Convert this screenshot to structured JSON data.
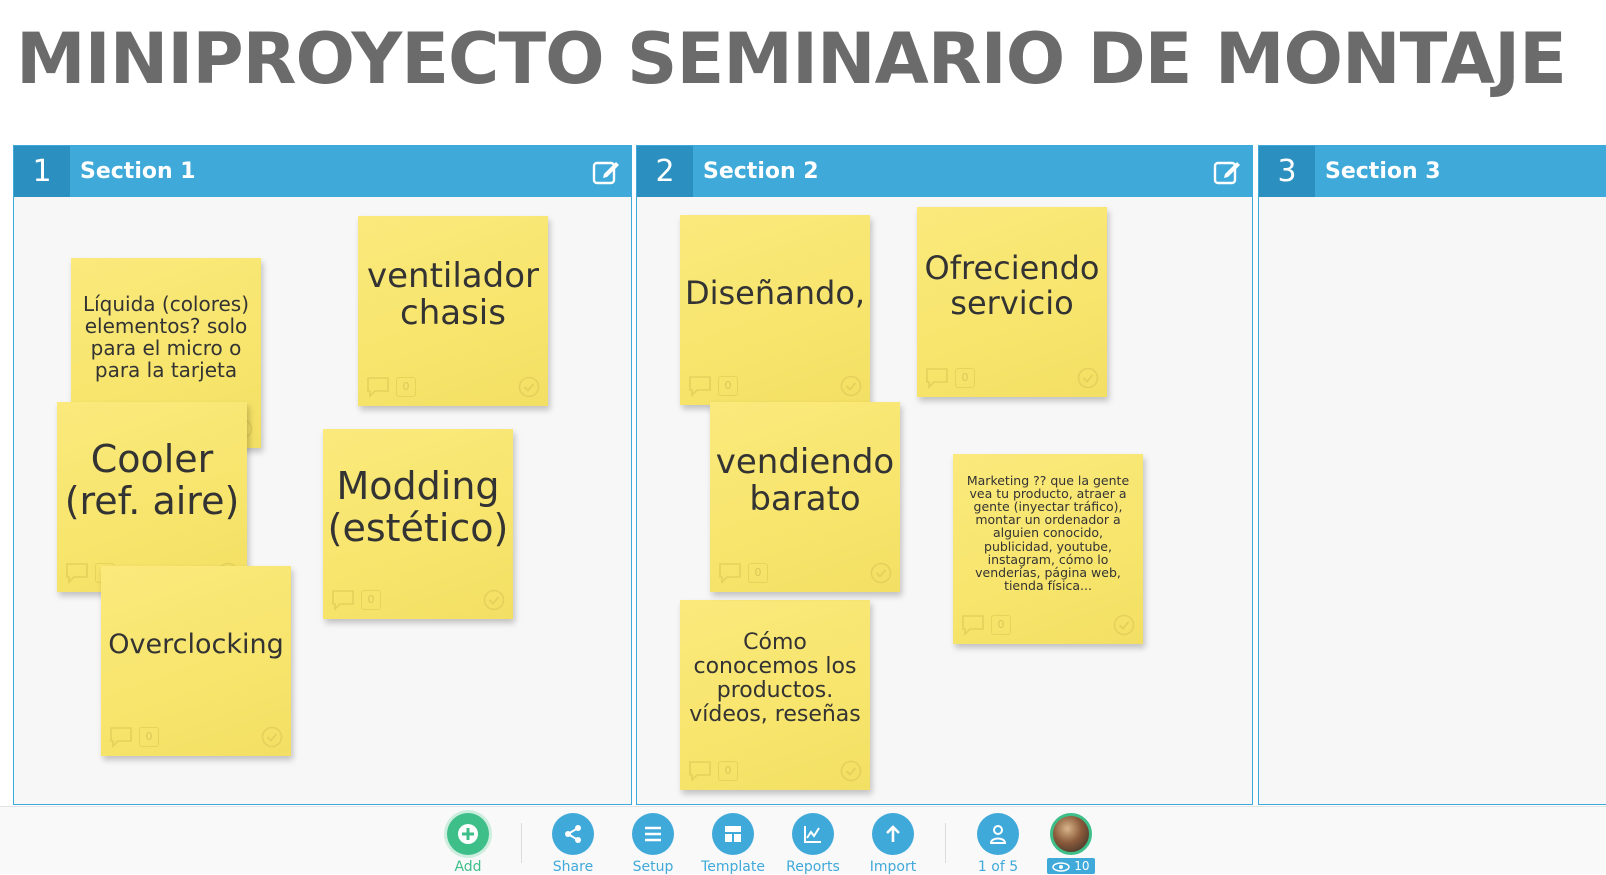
{
  "board": {
    "title": "MINIPROYECTO SEMINARIO DE MONTAJE"
  },
  "sections": [
    {
      "number": "1",
      "name": "Section 1"
    },
    {
      "number": "2",
      "name": "Section 2"
    },
    {
      "number": "3",
      "name": "Section 3"
    }
  ],
  "notes": [
    {
      "text": "Líquida (colores) elementos? solo para el micro o para la tarjeta",
      "comments": "0"
    },
    {
      "text": "ventilador chasis",
      "comments": "0"
    },
    {
      "text": "Cooler (ref. aire)",
      "comments": "0"
    },
    {
      "text": "Modding (estético)",
      "comments": "0"
    },
    {
      "text": "Overclocking",
      "comments": "0"
    },
    {
      "text": "Diseñando,",
      "comments": "0"
    },
    {
      "text": "Ofreciendo servicio",
      "comments": "0"
    },
    {
      "text": "vendiendo barato",
      "comments": "0"
    },
    {
      "text": "Marketing ?? que la gente vea tu producto, atraer a gente (inyectar tráfico), montar un ordenador a alguien conocido, publicidad, youtube, instagram, cómo lo venderías, página web, tienda física...",
      "comments": "0"
    },
    {
      "text": "Cómo conocemos los productos. vídeos, reseñas",
      "comments": "0"
    }
  ],
  "toolbar": {
    "add": "Add",
    "share": "Share",
    "setup": "Setup",
    "template": "Template",
    "reports": "Reports",
    "import": "Import",
    "participants": "1 of 5",
    "views_count": "10"
  },
  "colors": {
    "accent": "#3fa9da",
    "note": "#f6e46a",
    "add": "#3ebf8a"
  },
  "icons": [
    "edit-icon",
    "comment-icon",
    "check-icon",
    "plus-icon",
    "share-icon",
    "menu-icon",
    "template-icon",
    "chart-icon",
    "upload-icon",
    "user-icon",
    "eye-icon"
  ]
}
